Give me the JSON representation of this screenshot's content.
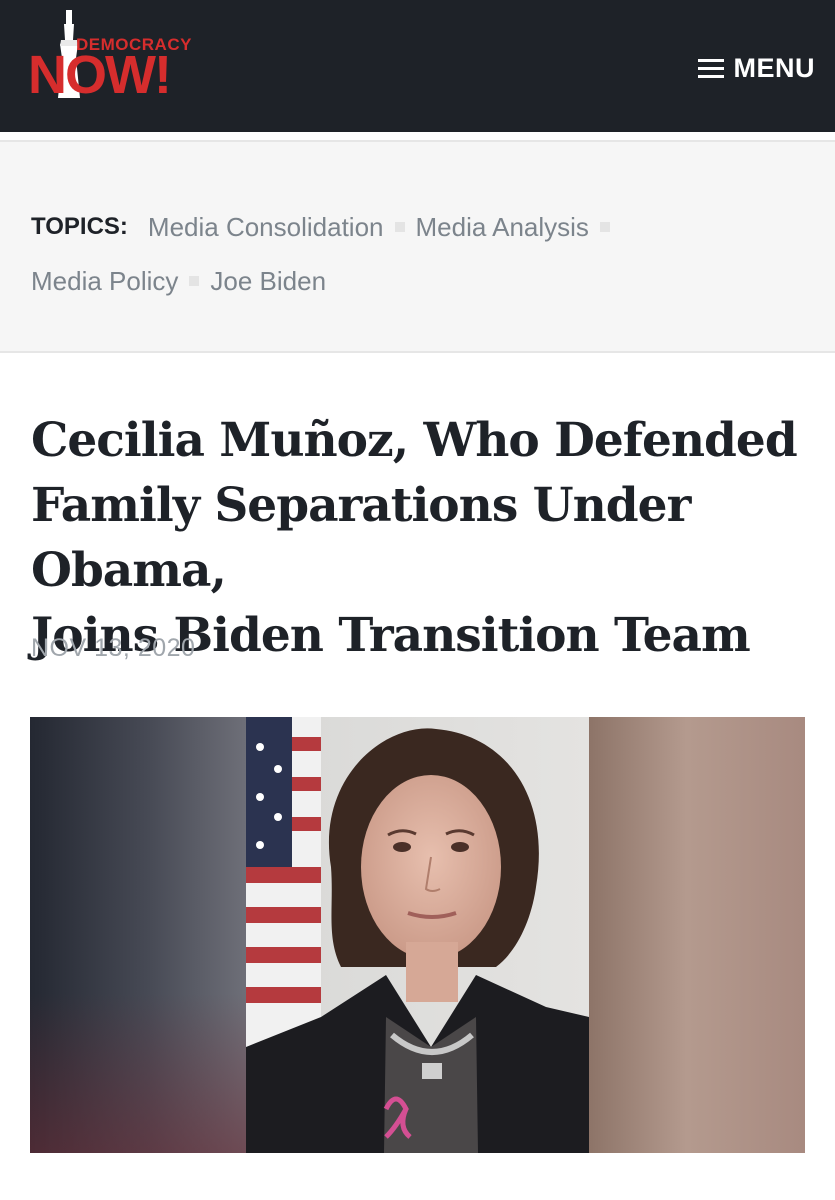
{
  "header": {
    "logo": {
      "top_word": "DEMOCRACY",
      "main_word": "NOW!",
      "icon": "statue-of-liberty-icon"
    },
    "menu_icon": "hamburger-menu-icon",
    "menu_label": "MENU",
    "colors": {
      "background": "#1e2228",
      "brand_red": "#d62d2d",
      "text": "#ffffff"
    }
  },
  "topics": {
    "label": "TOPICS:",
    "items": [
      "Media Consolidation",
      "Media Analysis",
      "Media Policy",
      "Joe Biden"
    ]
  },
  "article": {
    "title_lines": [
      "Cecilia Muñoz, Who Defended",
      "Family Separations Under Obama,",
      "Joins Biden Transition Team"
    ],
    "date": "NOV 13, 2020",
    "image_icon": "portrait-photo-icon"
  }
}
